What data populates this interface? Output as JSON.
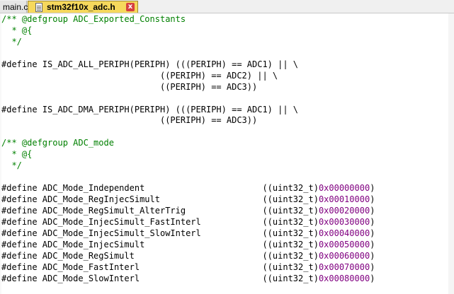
{
  "tabs": [
    {
      "label": "main.c",
      "active": false
    },
    {
      "label": "stm32f10x_adc.h",
      "active": true
    }
  ],
  "tab_close_glyph": "x",
  "colors": {
    "comment": "#008000",
    "number": "#800080",
    "active_tab": "#f6d85c"
  },
  "code_lines": [
    [
      {
        "t": "/** @defgroup ADC_Exported_Constants",
        "c": "cm"
      }
    ],
    [
      {
        "t": "  * @{",
        "c": "cm"
      }
    ],
    [
      {
        "t": "  */",
        "c": "cm"
      }
    ],
    [],
    [
      {
        "t": "#define IS_ADC_ALL_PERIPH(PERIPH) (((PERIPH) == ADC1) || \\",
        "c": "pp"
      }
    ],
    [
      {
        "t": "                               ((PERIPH) == ADC2) || \\",
        "c": "pp"
      }
    ],
    [
      {
        "t": "                               ((PERIPH) == ADC3))",
        "c": "pp"
      }
    ],
    [],
    [
      {
        "t": "#define IS_ADC_DMA_PERIPH(PERIPH) (((PERIPH) == ADC1) || \\",
        "c": "pp"
      }
    ],
    [
      {
        "t": "                               ((PERIPH) == ADC3))",
        "c": "pp"
      }
    ],
    [],
    [
      {
        "t": "/** @defgroup ADC_mode",
        "c": "cm"
      }
    ],
    [
      {
        "t": "  * @{",
        "c": "cm"
      }
    ],
    [
      {
        "t": "  */",
        "c": "cm"
      }
    ],
    [],
    [
      {
        "t": "#define ADC_Mode_Independent                       ((uint32_t)",
        "c": "pp"
      },
      {
        "t": "0x00000000",
        "c": "num"
      },
      {
        "t": ")",
        "c": "pp"
      }
    ],
    [
      {
        "t": "#define ADC_Mode_RegInjecSimult                    ((uint32_t)",
        "c": "pp"
      },
      {
        "t": "0x00010000",
        "c": "num"
      },
      {
        "t": ")",
        "c": "pp"
      }
    ],
    [
      {
        "t": "#define ADC_Mode_RegSimult_AlterTrig               ((uint32_t)",
        "c": "pp"
      },
      {
        "t": "0x00020000",
        "c": "num"
      },
      {
        "t": ")",
        "c": "pp"
      }
    ],
    [
      {
        "t": "#define ADC_Mode_InjecSimult_FastInterl            ((uint32_t)",
        "c": "pp"
      },
      {
        "t": "0x00030000",
        "c": "num"
      },
      {
        "t": ")",
        "c": "pp"
      }
    ],
    [
      {
        "t": "#define ADC_Mode_InjecSimult_SlowInterl            ((uint32_t)",
        "c": "pp"
      },
      {
        "t": "0x00040000",
        "c": "num"
      },
      {
        "t": ")",
        "c": "pp"
      }
    ],
    [
      {
        "t": "#define ADC_Mode_InjecSimult                       ((uint32_t)",
        "c": "pp"
      },
      {
        "t": "0x00050000",
        "c": "num"
      },
      {
        "t": ")",
        "c": "pp"
      }
    ],
    [
      {
        "t": "#define ADC_Mode_RegSimult                         ((uint32_t)",
        "c": "pp"
      },
      {
        "t": "0x00060000",
        "c": "num"
      },
      {
        "t": ")",
        "c": "pp"
      }
    ],
    [
      {
        "t": "#define ADC_Mode_FastInterl                        ((uint32_t)",
        "c": "pp"
      },
      {
        "t": "0x00070000",
        "c": "num"
      },
      {
        "t": ")",
        "c": "pp"
      }
    ],
    [
      {
        "t": "#define ADC_Mode_SlowInterl                        ((uint32_t)",
        "c": "pp"
      },
      {
        "t": "0x00080000",
        "c": "num"
      },
      {
        "t": ")",
        "c": "pp"
      }
    ]
  ]
}
